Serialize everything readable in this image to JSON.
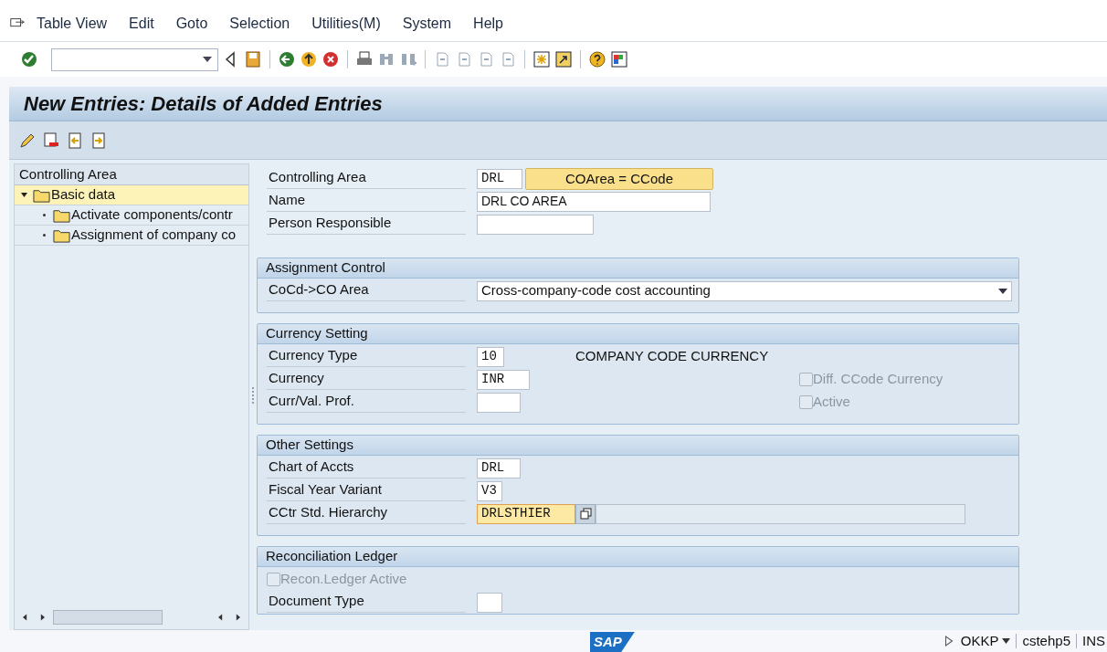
{
  "menu_bar": [
    "Table View",
    "Edit",
    "Goto",
    "Selection",
    "Utilities(M)",
    "System",
    "Help"
  ],
  "title": "New Entries: Details of Added Entries",
  "tree": {
    "header": "Controlling Area",
    "items": [
      {
        "label": "Basic data",
        "selected": true,
        "expanded": true,
        "children": [
          {
            "label": "Activate components/contr",
            "selected": false
          },
          {
            "label": "Assignment of company co",
            "selected": false
          }
        ]
      }
    ]
  },
  "header_fields": [
    {
      "kind": "input",
      "label": "Controlling Area",
      "value": "DRL",
      "button": "COArea = CCode"
    },
    {
      "kind": "input",
      "label": "Name",
      "value": "DRL CO AREA"
    },
    {
      "kind": "input",
      "label": "Person Responsible"
    }
  ],
  "sections": [
    {
      "title": "Assignment Control",
      "rows": [
        {
          "kind": "dropdown",
          "label": "CoCd->CO Area",
          "value": "Cross-company-code cost accounting"
        }
      ]
    },
    {
      "title": "Currency Setting",
      "rows": [
        {
          "kind": "input",
          "label": "Currency Type",
          "value": "10",
          "note": "COMPANY CODE CURRENCY"
        },
        {
          "kind": "input",
          "label": "Currency",
          "value": "INR",
          "checkbox": {
            "label": "Diff. CCode Currency",
            "checked": false,
            "disabled": true
          }
        },
        {
          "kind": "input",
          "label": "Curr/Val. Prof.",
          "checkbox": {
            "label": "Active",
            "checked": false,
            "disabled": true
          }
        }
      ]
    },
    {
      "title": "Other Settings",
      "rows": [
        {
          "kind": "input",
          "label": "Chart of Accts",
          "value": "DRL"
        },
        {
          "kind": "input",
          "label": "Fiscal Year Variant",
          "value": "V3"
        },
        {
          "kind": "input",
          "label": "CCtr Std. Hierarchy",
          "value": "DRLSTHIER",
          "focused": true,
          "value_help": true
        }
      ]
    },
    {
      "title": "Reconciliation Ledger",
      "rows": [
        {
          "kind": "checkbox",
          "label": "Recon.Ledger Active",
          "checked": false,
          "disabled": true
        },
        {
          "kind": "input",
          "label": "Document Type"
        }
      ]
    }
  ],
  "status_bar": {
    "logo": "SAP",
    "transaction": "OKKP",
    "server": "cstehp5",
    "mode": "INS"
  }
}
